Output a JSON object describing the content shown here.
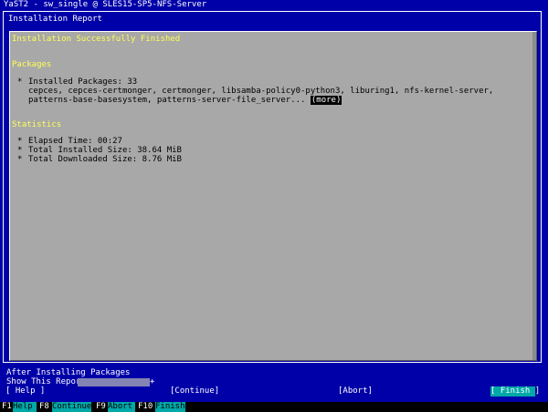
{
  "window": {
    "title": "YaST2 - sw_single @ SLES15-SP5-NFS-Server"
  },
  "dialog": {
    "title": "Installation Report"
  },
  "report": {
    "heading": "Installation Successfully Finished",
    "packages_heading": "Packages",
    "installed_packages": "Installed Packages: 33",
    "package_list_line1": "cepces, cepces-certmonger, certmonger, libsamba-policy0-python3, liburing1, nfs-kernel-server,",
    "package_list_line2": "patterns-base-basesystem, patterns-server-file_server...",
    "more_label": "(more)",
    "statistics_heading": "Statistics",
    "elapsed_time": "Elapsed Time: 00:27",
    "total_installed_size": "Total Installed Size: 38.64 MiB",
    "total_downloaded_size": "Total Downloaded Size: 8.76 MiB",
    "bullet": "*"
  },
  "after": {
    "label": "After Installing Packages",
    "option_label": "Show This Report",
    "option_suffix": "+"
  },
  "buttons": {
    "help": "[ Help ]",
    "continue": "[Continue]",
    "abort": "[Abort]",
    "finish": "[ Finish ]"
  },
  "fkeys": [
    {
      "key": "F1",
      "label": "Help"
    },
    {
      "key": "F8",
      "label": "Continue"
    },
    {
      "key": "F9",
      "label": "Abort"
    },
    {
      "key": "F10",
      "label": "Finish"
    }
  ],
  "colors": {
    "background": "#0000a8",
    "panel": "#a8a8a8",
    "heading": "#ffff54",
    "focus": "#00a8a8"
  }
}
